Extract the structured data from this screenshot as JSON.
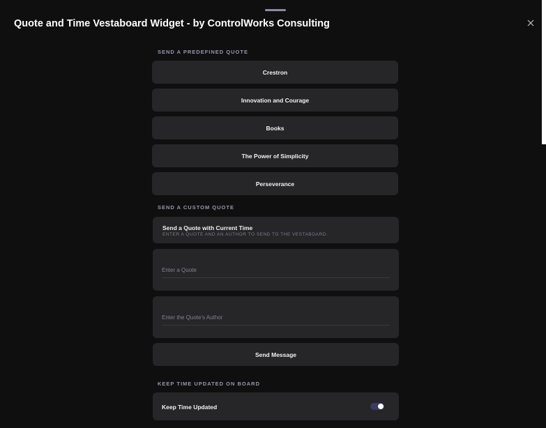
{
  "header": {
    "title": "Quote and Time Vestaboard Widget - by ControlWorks Consulting",
    "close_icon": "close-icon"
  },
  "predefined": {
    "section_label": "SEND A PREDEFINED QUOTE",
    "quotes": [
      {
        "label": "Crestron"
      },
      {
        "label": "Innovation and Courage"
      },
      {
        "label": "Books"
      },
      {
        "label": "The Power of Simplicity"
      },
      {
        "label": "Perseverance"
      }
    ]
  },
  "custom": {
    "section_label": "SEND A CUSTOM QUOTE",
    "card_title": "Send a Quote with Current Time",
    "card_subtitle": "ENTER A QUOTE AND AN AUTHOR TO SEND TO THE VESTABOARD.",
    "quote_field": {
      "value": "",
      "placeholder": "Enter a Quote"
    },
    "author_field": {
      "value": "",
      "placeholder": "Enter the Quote's Author"
    },
    "send_label": "Send Message"
  },
  "time": {
    "section_label": "KEEP TIME UPDATED ON BOARD",
    "toggle_label": "Keep Time Updated",
    "toggle_state": "off"
  },
  "colors": {
    "background": "#0f0f10",
    "card": "#262528",
    "toggle_track": "#3b3a60"
  }
}
